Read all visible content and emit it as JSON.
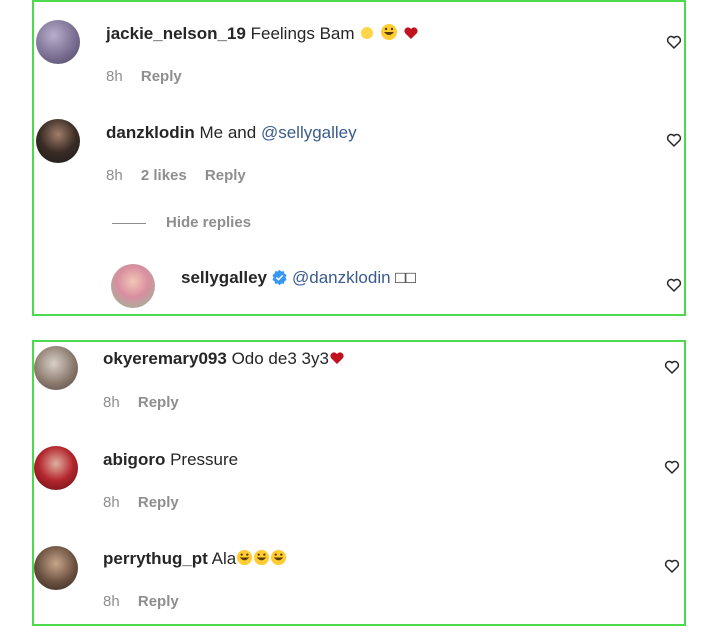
{
  "panel1": {
    "comments": [
      {
        "username": "jackie_nelson_19",
        "text": "Feelings Bam",
        "time": "8h",
        "reply": "Reply"
      },
      {
        "username": "danzklodin",
        "text": "Me and",
        "mention": "@sellygalley",
        "time": "8h",
        "likes": "2 likes",
        "reply": "Reply"
      }
    ],
    "hide_replies": "Hide replies",
    "reply_comment": {
      "username": "sellygalley",
      "mention": "@danzklodin",
      "trailing": "□□"
    }
  },
  "panel2": {
    "comments": [
      {
        "username": "okyeremary093",
        "text": "Odo de3 3y3",
        "time": "8h",
        "reply": "Reply"
      },
      {
        "username": "abigoro",
        "text": "Pressure",
        "time": "8h",
        "reply": "Reply"
      },
      {
        "username": "perrythug_pt",
        "text": "Ala",
        "time": "8h",
        "reply": "Reply"
      }
    ]
  },
  "icons": {
    "like": "heart-outline-icon",
    "verified": "verified-badge-icon"
  },
  "colors": {
    "border": "#4cd94c",
    "mention": "#3a5b8c",
    "meta": "#8e8e8e",
    "verified": "#3897f0",
    "red_heart": "#c1121f"
  }
}
